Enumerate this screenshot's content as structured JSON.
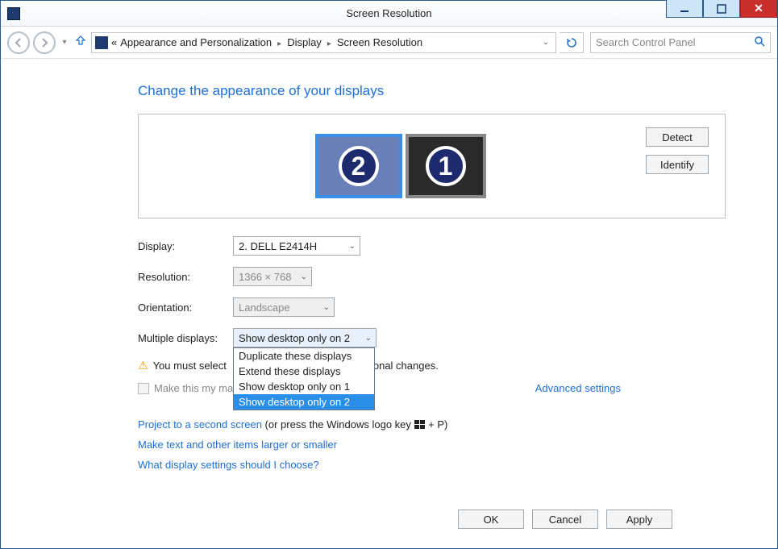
{
  "window": {
    "title": "Screen Resolution"
  },
  "breadcrumb": {
    "root_glyph": "«",
    "items": [
      "Appearance and Personalization",
      "Display",
      "Screen Resolution"
    ]
  },
  "search": {
    "placeholder": "Search Control Panel"
  },
  "heading": "Change the appearance of your displays",
  "panel_buttons": {
    "detect": "Detect",
    "identify": "Identify"
  },
  "monitors": {
    "primary": "2",
    "secondary": "1"
  },
  "form": {
    "display_label": "Display:",
    "display_value": "2. DELL E2414H",
    "resolution_label": "Resolution:",
    "resolution_value": "1366 × 768",
    "orientation_label": "Orientation:",
    "orientation_value": "Landscape",
    "multi_label": "Multiple displays:",
    "multi_value": "Show desktop only on 2"
  },
  "dropdown_options": [
    "Duplicate these displays",
    "Extend these displays",
    "Show desktop only on 1",
    "Show desktop only on 2"
  ],
  "warning_prefix": "You must select",
  "warning_suffix": "onal changes.",
  "checkbox_label": "Make this my ma",
  "advanced": "Advanced settings",
  "links": {
    "project": "Project to a second screen",
    "project_suffix_a": " (or press the Windows logo key ",
    "project_suffix_b": " + P)",
    "textsize": "Make text and other items larger or smaller",
    "help": "What display settings should I choose?"
  },
  "buttons": {
    "ok": "OK",
    "cancel": "Cancel",
    "apply": "Apply"
  }
}
